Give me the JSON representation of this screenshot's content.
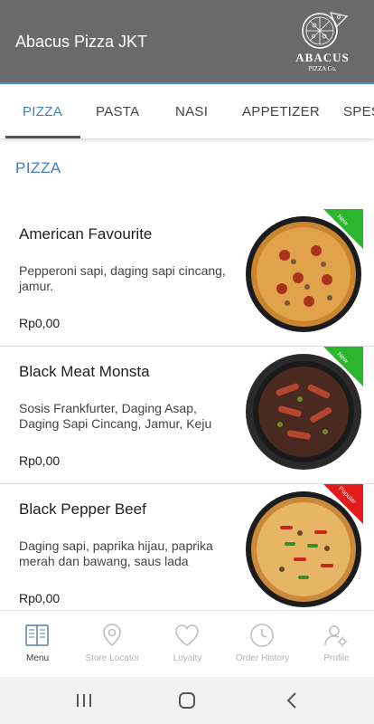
{
  "header": {
    "title": "Abacus Pizza JKT",
    "logo_name": "ABACUS",
    "logo_sub": "PIZZA Co."
  },
  "tabs": [
    {
      "label": "PIZZA",
      "active": true
    },
    {
      "label": "PASTA",
      "active": false
    },
    {
      "label": "NASI",
      "active": false
    },
    {
      "label": "APPETIZER",
      "active": false
    },
    {
      "label": "SPES",
      "active": false
    }
  ],
  "section": {
    "title": "PIZZA"
  },
  "items": [
    {
      "name": "American Favourite",
      "description": "Pepperoni sapi, daging sapi cincang, jamur.",
      "price": "Rp0,00",
      "badge": "New",
      "badge_color": "#2db52d"
    },
    {
      "name": "Black Meat Monsta",
      "description": "Sosis Frankfurter, Daging Asap, Daging Sapi Cincang, Jamur, Keju",
      "price": "Rp0,00",
      "badge": "New",
      "badge_color": "#2db52d"
    },
    {
      "name": "Black Pepper Beef",
      "description": "Daging sapi, paprika hijau, paprika merah dan bawang, saus lada",
      "price": "Rp0,00",
      "badge": "Popular",
      "badge_color": "#e31b1b"
    }
  ],
  "bottom_nav": [
    {
      "label": "Menu",
      "icon": "menu-book-icon",
      "active": true
    },
    {
      "label": "Store Locator",
      "icon": "location-pin-icon",
      "active": false
    },
    {
      "label": "Loyalty",
      "icon": "heart-icon",
      "active": false
    },
    {
      "label": "Order History",
      "icon": "clock-icon",
      "active": false
    },
    {
      "label": "Profile",
      "icon": "profile-settings-icon",
      "active": false
    }
  ],
  "system_nav": [
    "recent-apps-icon",
    "home-icon",
    "back-icon"
  ],
  "colors": {
    "header_bg": "#6a6a6a",
    "accent": "#3b7fc4",
    "new_badge": "#2db52d",
    "popular_badge": "#e31b1b"
  }
}
